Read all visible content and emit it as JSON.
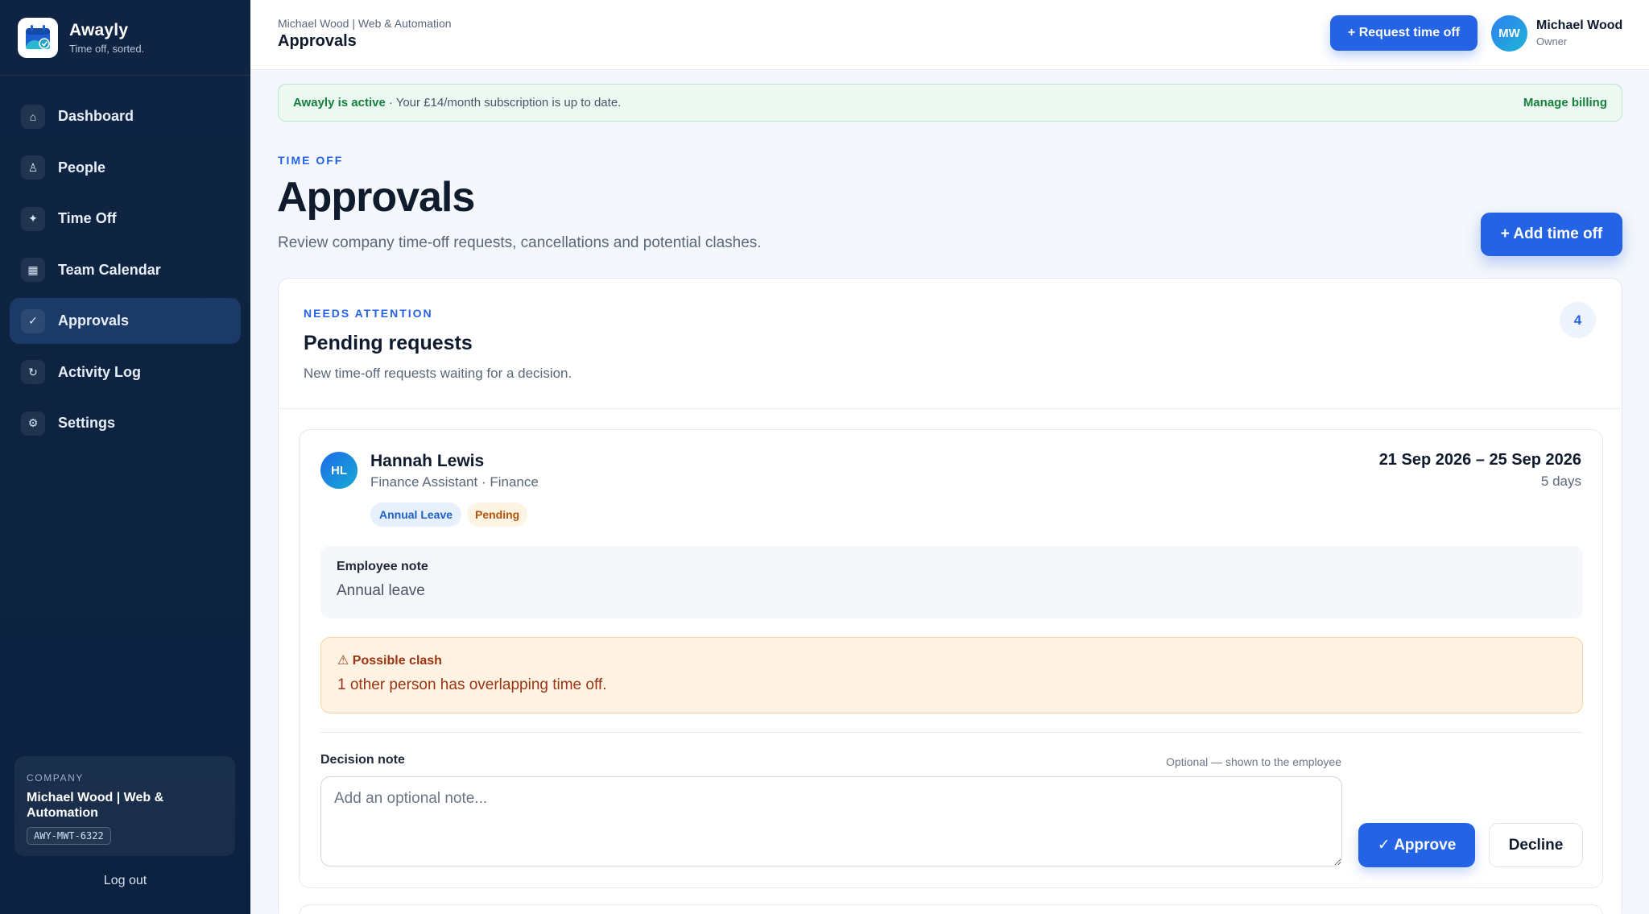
{
  "brand": {
    "name": "Awayly",
    "tagline": "Time off, sorted.",
    "logo_icon": "calendar-check-icon"
  },
  "sidebar": {
    "items": [
      {
        "label": "Dashboard",
        "icon": "house-icon",
        "glyph": "⌂",
        "active": false
      },
      {
        "label": "People",
        "icon": "person-icon",
        "glyph": "♙",
        "active": false
      },
      {
        "label": "Time Off",
        "icon": "sparkle-icon",
        "glyph": "✦",
        "active": false
      },
      {
        "label": "Team Calendar",
        "icon": "calendar-icon",
        "glyph": "▦",
        "active": false
      },
      {
        "label": "Approvals",
        "icon": "check-icon",
        "glyph": "✓",
        "active": true
      },
      {
        "label": "Activity Log",
        "icon": "refresh-icon",
        "glyph": "↻",
        "active": false
      },
      {
        "label": "Settings",
        "icon": "gear-icon",
        "glyph": "⚙",
        "active": false
      }
    ],
    "company": {
      "kicker": "COMPANY",
      "name": "Michael Wood | Web & Automation",
      "code": "AWY-MWT-6322"
    },
    "logout_label": "Log out"
  },
  "topbar": {
    "breadcrumb": "Michael Wood | Web & Automation",
    "title": "Approvals",
    "request_button": "+ Request time off",
    "user": {
      "initials": "MW",
      "name": "Michael Wood",
      "role": "Owner"
    }
  },
  "banner": {
    "strong": "Awayly is active",
    "text": "· Your £14/month subscription is up to date.",
    "link": "Manage billing"
  },
  "page": {
    "kicker": "TIME OFF",
    "title": "Approvals",
    "subtitle": "Review company time-off requests, cancellations and potential clashes.",
    "add_button": "+ Add time off"
  },
  "pending": {
    "kicker": "NEEDS ATTENTION",
    "title": "Pending requests",
    "subtitle": "New time-off requests waiting for a decision.",
    "count": "4",
    "requests": [
      {
        "initials": "HL",
        "name": "Hannah Lewis",
        "role": "Finance Assistant · Finance",
        "type": "Annual Leave",
        "status": "Pending",
        "dates": "21 Sep 2026 – 25 Sep 2026",
        "days": "5 days",
        "note_label": "Employee note",
        "note": "Annual leave",
        "clash_title": "⚠ Possible clash",
        "clash_text": "1 other person has overlapping time off.",
        "decision_label": "Decision note",
        "decision_hint": "Optional — shown to the employee",
        "decision_placeholder": "Add an optional note...",
        "decision_value": "",
        "approve_label": "✓ Approve",
        "decline_label": "Decline"
      }
    ]
  },
  "colors": {
    "accent": "#2463e3",
    "sidebar": "#0f2442",
    "success": "#15803d",
    "warning": "#9a3412"
  }
}
